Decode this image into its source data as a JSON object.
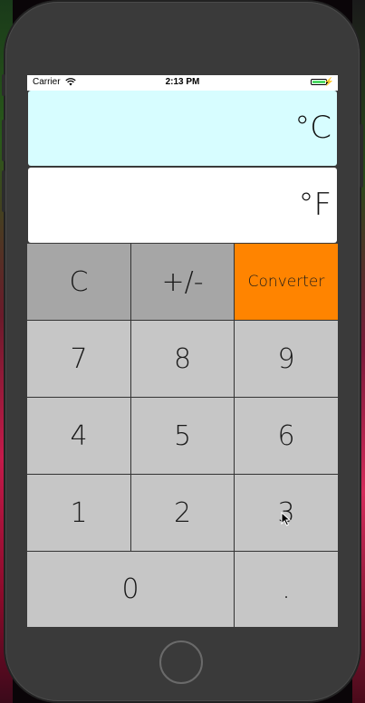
{
  "status_bar": {
    "carrier": "Carrier",
    "time": "2:13 PM",
    "battery_level": 1.0
  },
  "displays": {
    "celsius": "°C",
    "fahrenheit": "°F"
  },
  "keys": {
    "clear": "C",
    "sign": "+/-",
    "converter": "Converter",
    "k7": "7",
    "k8": "8",
    "k9": "9",
    "k4": "4",
    "k5": "5",
    "k6": "6",
    "k1": "1",
    "k2": "2",
    "k3": "3",
    "k0": "0",
    "dot": "."
  },
  "colors": {
    "celsius_display": "#d7fdff",
    "fahrenheit_display": "#ffffff",
    "function_key": "#a6a6a6",
    "digit_key": "#c6c6c6",
    "converter_key": "#ff8400",
    "device_body": "#3a3a3a"
  }
}
